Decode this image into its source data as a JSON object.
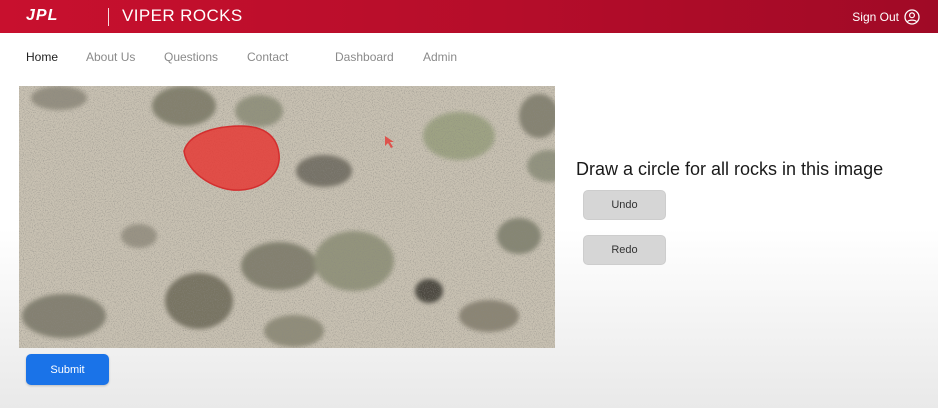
{
  "header": {
    "logo_text": "JPL",
    "app_title": "VIPER ROCKS",
    "signout_label": "Sign Out",
    "brand_color": "#c8102e",
    "user_icon": "user-circle-icon"
  },
  "nav": {
    "items": [
      {
        "label": "Home",
        "active": true
      },
      {
        "label": "About Us"
      },
      {
        "label": "Questions"
      },
      {
        "label": "Contact"
      },
      {
        "label": "Dashboard"
      },
      {
        "label": "Admin"
      }
    ]
  },
  "task": {
    "instruction": "Draw a circle for all rocks in this image",
    "undo_label": "Undo",
    "redo_label": "Redo",
    "submit_label": "Submit",
    "submit_color": "#1a73e8",
    "annotation_color": "#e53935"
  }
}
